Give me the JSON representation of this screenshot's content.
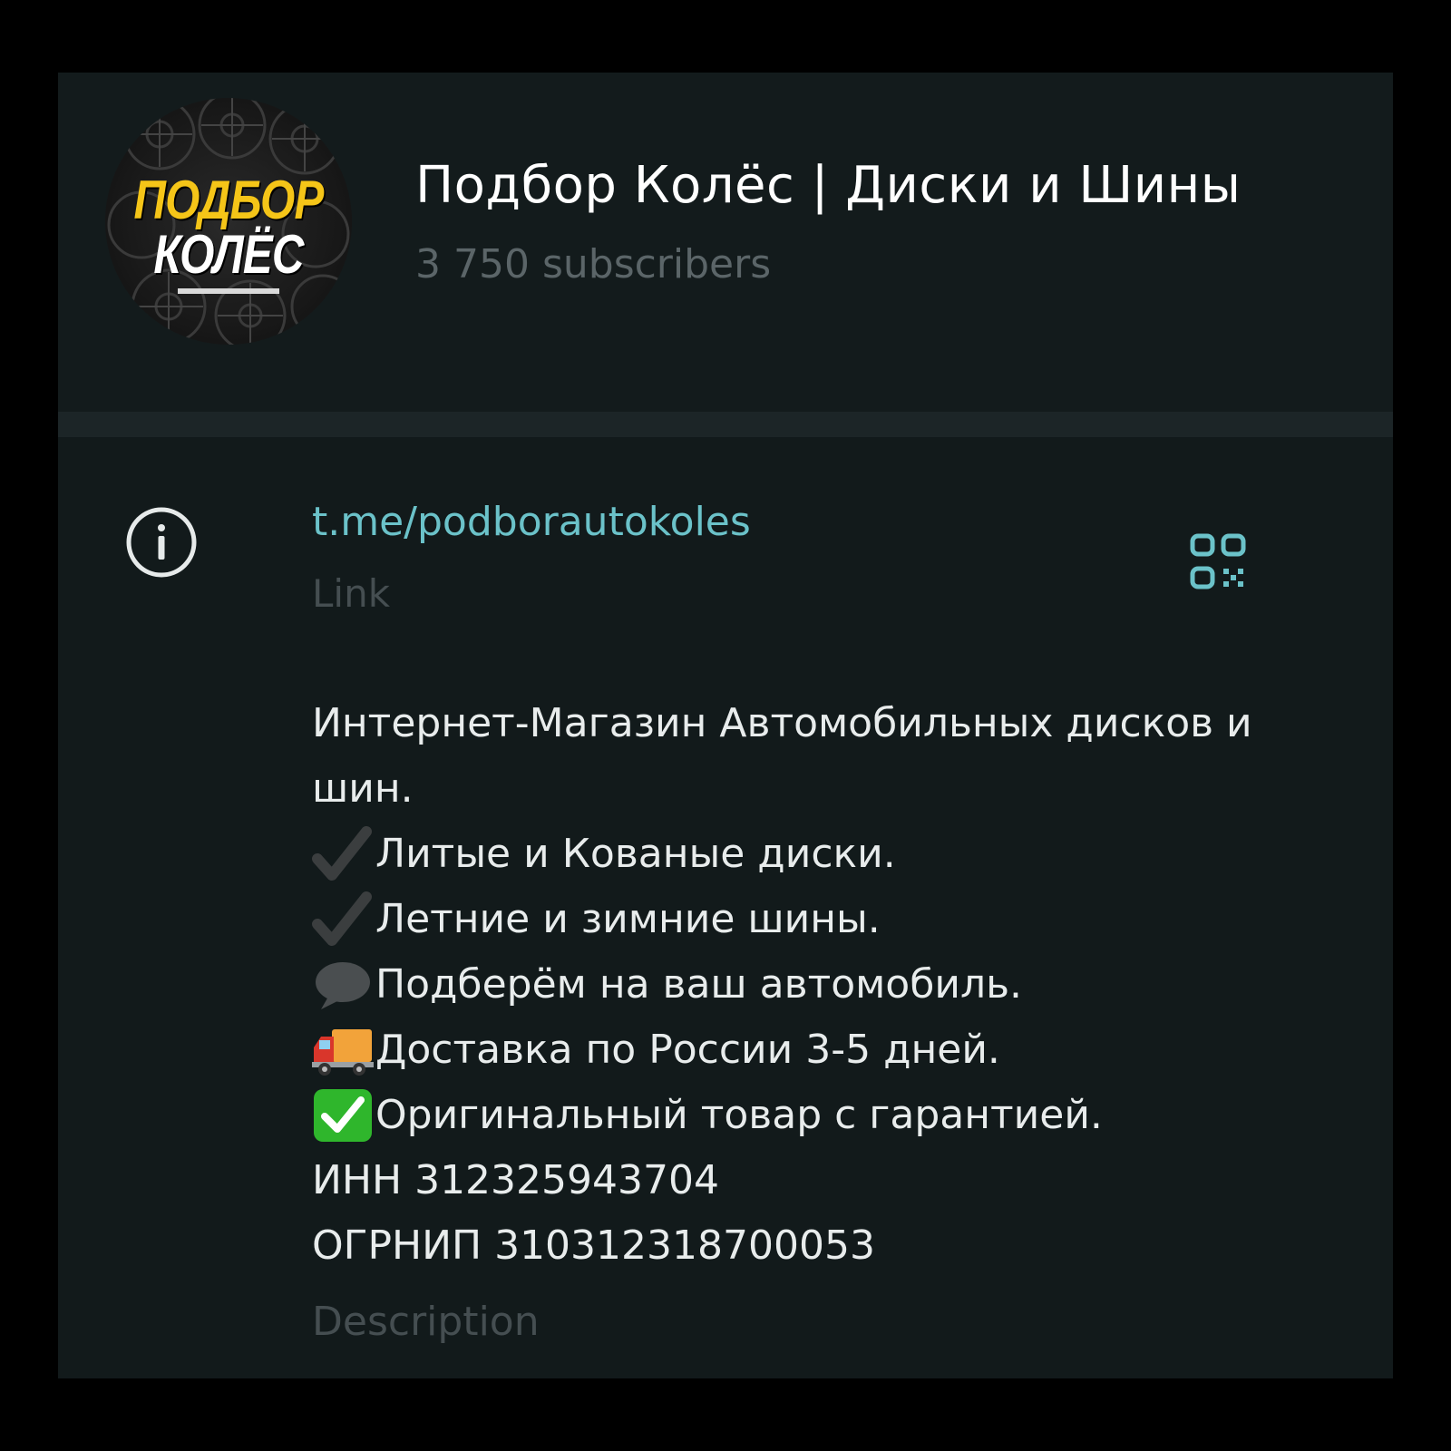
{
  "channel": {
    "avatar": {
      "logo_line1": "ПОДБОР",
      "logo_line2": "КОЛЁС"
    },
    "title": "Подбор Колёс | Диски и Шины",
    "subscribers": "3 750 subscribers"
  },
  "info": {
    "icon": "info-icon",
    "link": "t.me/podborautokoles",
    "link_label": "Link",
    "qr_icon": "qr-code-icon",
    "description_lines": [
      {
        "emoji": "",
        "text": "Интернет-Магазин Автомобильных дисков и"
      },
      {
        "emoji": "",
        "text": "шин."
      },
      {
        "emoji": "check-mark-icon",
        "text": "Литые и Кованые диски."
      },
      {
        "emoji": "check-mark-icon",
        "text": "Летние и зимние шины."
      },
      {
        "emoji": "speech-bubble-icon",
        "text": "Подберём на ваш автомобиль."
      },
      {
        "emoji": "delivery-truck-icon",
        "text": "Доставка по России 3-5 дней."
      },
      {
        "emoji": "check-box-icon",
        "text": "Оригинальный товар с гарантией."
      },
      {
        "emoji": "",
        "text": "ИНН 312325943704"
      },
      {
        "emoji": "",
        "text": "ОГРНИП 310312318700053"
      }
    ],
    "description_label": "Description"
  },
  "colors": {
    "background": "#000000",
    "panel": "#121a1b",
    "link": "#6bc2c9",
    "muted": "#454e51",
    "accent_logo": "#f5c518"
  }
}
